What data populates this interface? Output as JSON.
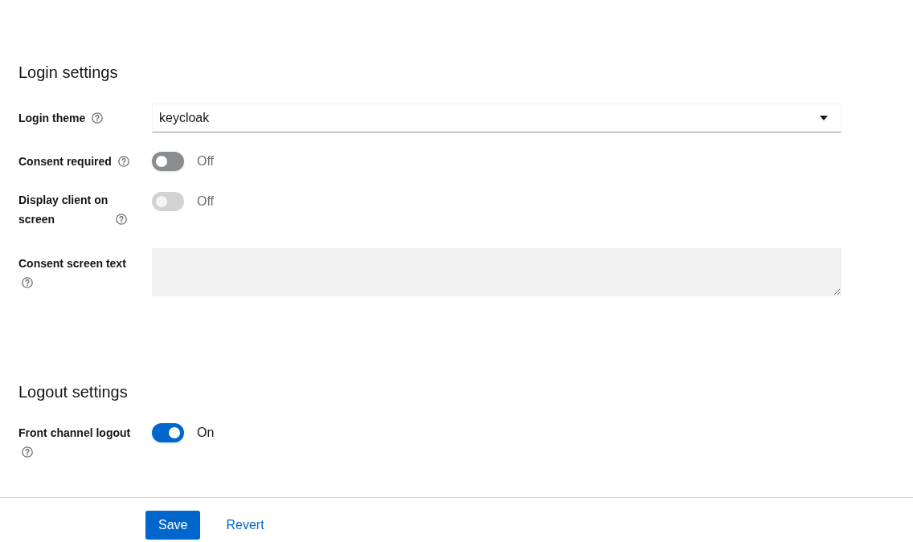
{
  "sections": [
    {
      "title": "Login settings",
      "fields": [
        {
          "kind": "select",
          "label": "Login theme",
          "value": "keycloak"
        },
        {
          "kind": "switch",
          "label": "Consent required",
          "on": false,
          "disabled": false,
          "status_text": "Off"
        },
        {
          "kind": "switch",
          "label": "Display client on screen",
          "on": false,
          "disabled": true,
          "status_text": "Off"
        },
        {
          "kind": "textarea",
          "label": "Consent screen text",
          "disabled": true
        }
      ]
    },
    {
      "title": "Logout settings",
      "fields": [
        {
          "kind": "switch",
          "label": "Front channel logout",
          "on": true,
          "disabled": false,
          "status_text": "On"
        }
      ]
    }
  ],
  "actions": [
    {
      "kind": "primary",
      "label": "Save"
    },
    {
      "kind": "link",
      "label": "Revert"
    }
  ]
}
